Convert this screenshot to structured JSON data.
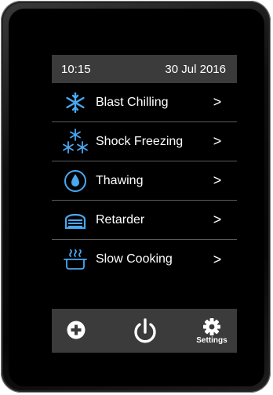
{
  "status": {
    "time": "10:15",
    "date": "30 Jul 2016"
  },
  "menu": {
    "items": [
      {
        "label": "Blast Chilling",
        "chevron": ">",
        "icon": "snowflake-icon"
      },
      {
        "label": "Shock Freezing",
        "chevron": ">",
        "icon": "snowflakes-icon"
      },
      {
        "label": "Thawing",
        "chevron": ">",
        "icon": "water-drop-icon"
      },
      {
        "label": "Retarder",
        "chevron": ">",
        "icon": "bread-loaf-icon"
      },
      {
        "label": "Slow Cooking",
        "chevron": ">",
        "icon": "cooking-pot-icon"
      }
    ]
  },
  "bottom": {
    "settings_label": "Settings"
  },
  "colors": {
    "accent": "#4aa8f0",
    "bar": "#3b3b3b"
  }
}
